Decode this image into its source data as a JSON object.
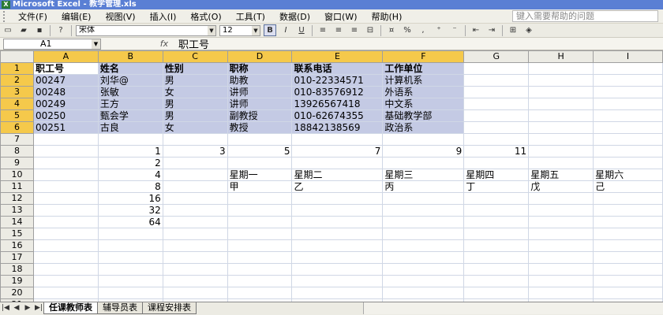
{
  "window": {
    "title": "Microsoft Excel - 教学管理.xls"
  },
  "menu": {
    "items": [
      "文件(F)",
      "编辑(E)",
      "视图(V)",
      "插入(I)",
      "格式(O)",
      "工具(T)",
      "数据(D)",
      "窗口(W)",
      "帮助(H)"
    ],
    "help_placeholder": "键入需要帮助的问题"
  },
  "toolbar": {
    "font_name": "宋体",
    "font_size": "12",
    "bold_label": "B",
    "italic_label": "I",
    "underline_label": "U",
    "percent_label": "%"
  },
  "formula_bar": {
    "cell_ref": "A1",
    "fx": "fx",
    "value": "职工号"
  },
  "sheet": {
    "columns": [
      "A",
      "B",
      "C",
      "D",
      "E",
      "F",
      "G",
      "H",
      "I"
    ],
    "rows": [
      [
        "职工号",
        "姓名",
        "性别",
        "职称",
        "联系电话",
        "工作单位",
        "",
        "",
        ""
      ],
      [
        "00247",
        "刘华@",
        "男",
        "助教",
        "010-22334571",
        "计算机系",
        "",
        "",
        ""
      ],
      [
        "00248",
        "张敏",
        "女",
        "讲师",
        "010-83576912",
        "外语系",
        "",
        "",
        ""
      ],
      [
        "00249",
        "王方",
        "男",
        "讲师",
        "13926567418",
        "中文系",
        "",
        "",
        ""
      ],
      [
        "00250",
        "甄会学",
        "男",
        "副教授",
        "010-62674355",
        "基础教学部",
        "",
        "",
        ""
      ],
      [
        "00251",
        "古良",
        "女",
        "教授",
        "18842138569",
        "政治系",
        "",
        "",
        ""
      ],
      [
        "",
        "",
        "",
        "",
        "",
        "",
        "",
        "",
        ""
      ],
      [
        "",
        "1",
        "3",
        "5",
        "7",
        "9",
        "11",
        "",
        ""
      ],
      [
        "",
        "2",
        "",
        "",
        "",
        "",
        "",
        "",
        ""
      ],
      [
        "",
        "4",
        "",
        "星期一",
        "星期二",
        "星期三",
        "星期四",
        "星期五",
        "星期六"
      ],
      [
        "",
        "8",
        "",
        "甲",
        "乙",
        "丙",
        "丁",
        "戊",
        "己"
      ],
      [
        "",
        "16",
        "",
        "",
        "",
        "",
        "",
        "",
        ""
      ],
      [
        "",
        "32",
        "",
        "",
        "",
        "",
        "",
        "",
        ""
      ],
      [
        "",
        "64",
        "",
        "",
        "",
        "",
        "",
        "",
        ""
      ],
      [
        "",
        "",
        "",
        "",
        "",
        "",
        "",
        "",
        ""
      ],
      [
        "",
        "",
        "",
        "",
        "",
        "",
        "",
        "",
        ""
      ],
      [
        "",
        "",
        "",
        "",
        "",
        "",
        "",
        "",
        ""
      ],
      [
        "",
        "",
        "",
        "",
        "",
        "",
        "",
        "",
        ""
      ],
      [
        "",
        "",
        "",
        "",
        "",
        "",
        "",
        "",
        ""
      ],
      [
        "",
        "",
        "",
        "",
        "",
        "",
        "",
        "",
        ""
      ],
      [
        "",
        "",
        "",
        "",
        "",
        "",
        "",
        "",
        ""
      ],
      [
        "",
        "",
        "",
        "",
        "",
        "",
        "",
        "",
        ""
      ]
    ]
  },
  "tabs": [
    "任课教师表",
    "辅导员表",
    "课程安排表"
  ],
  "colors": {
    "selection": "#c4cae4",
    "header_highlight": "#f5c94b",
    "title_bar": "#5a7fd4"
  }
}
